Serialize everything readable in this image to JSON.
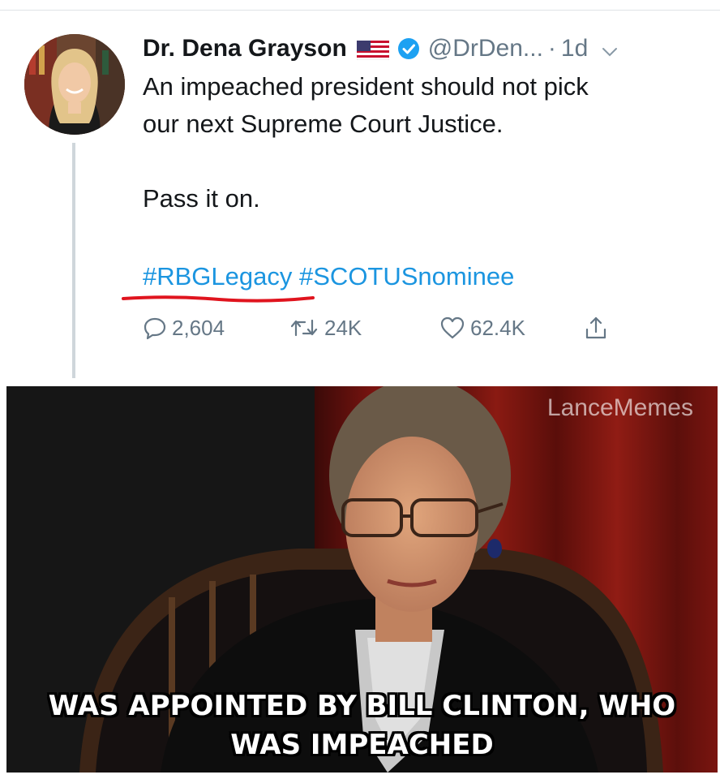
{
  "tweet": {
    "author_name": "Dr. Dena Grayson",
    "handle": "@DrDen...",
    "separator": "·",
    "timestamp": "1d",
    "icons": [
      "flag-icon",
      "verified-icon",
      "chevron-down-icon",
      "reply-icon",
      "retweet-icon",
      "like-icon",
      "share-icon"
    ],
    "text_line_1": "An impeached president should not pick",
    "text_line_2": "our next Supreme Court Justice.",
    "text_line_3": "Pass it on.",
    "hashtags": [
      "#RBGLegacy",
      "#SCOTUSnominee"
    ],
    "replies": "2,604",
    "retweets": "24K",
    "likes": "62.4K"
  },
  "meme": {
    "watermark": "LanceMemes",
    "caption_line_1": "WAS APPOINTED BY BILL CLINTON, WHO",
    "caption_line_2": "WAS IMPEACHED"
  },
  "colors": {
    "link": "#1b95e0",
    "secondary_text": "#657786",
    "verified": "#1da1f2",
    "annotation_underline": "#e0141e"
  }
}
